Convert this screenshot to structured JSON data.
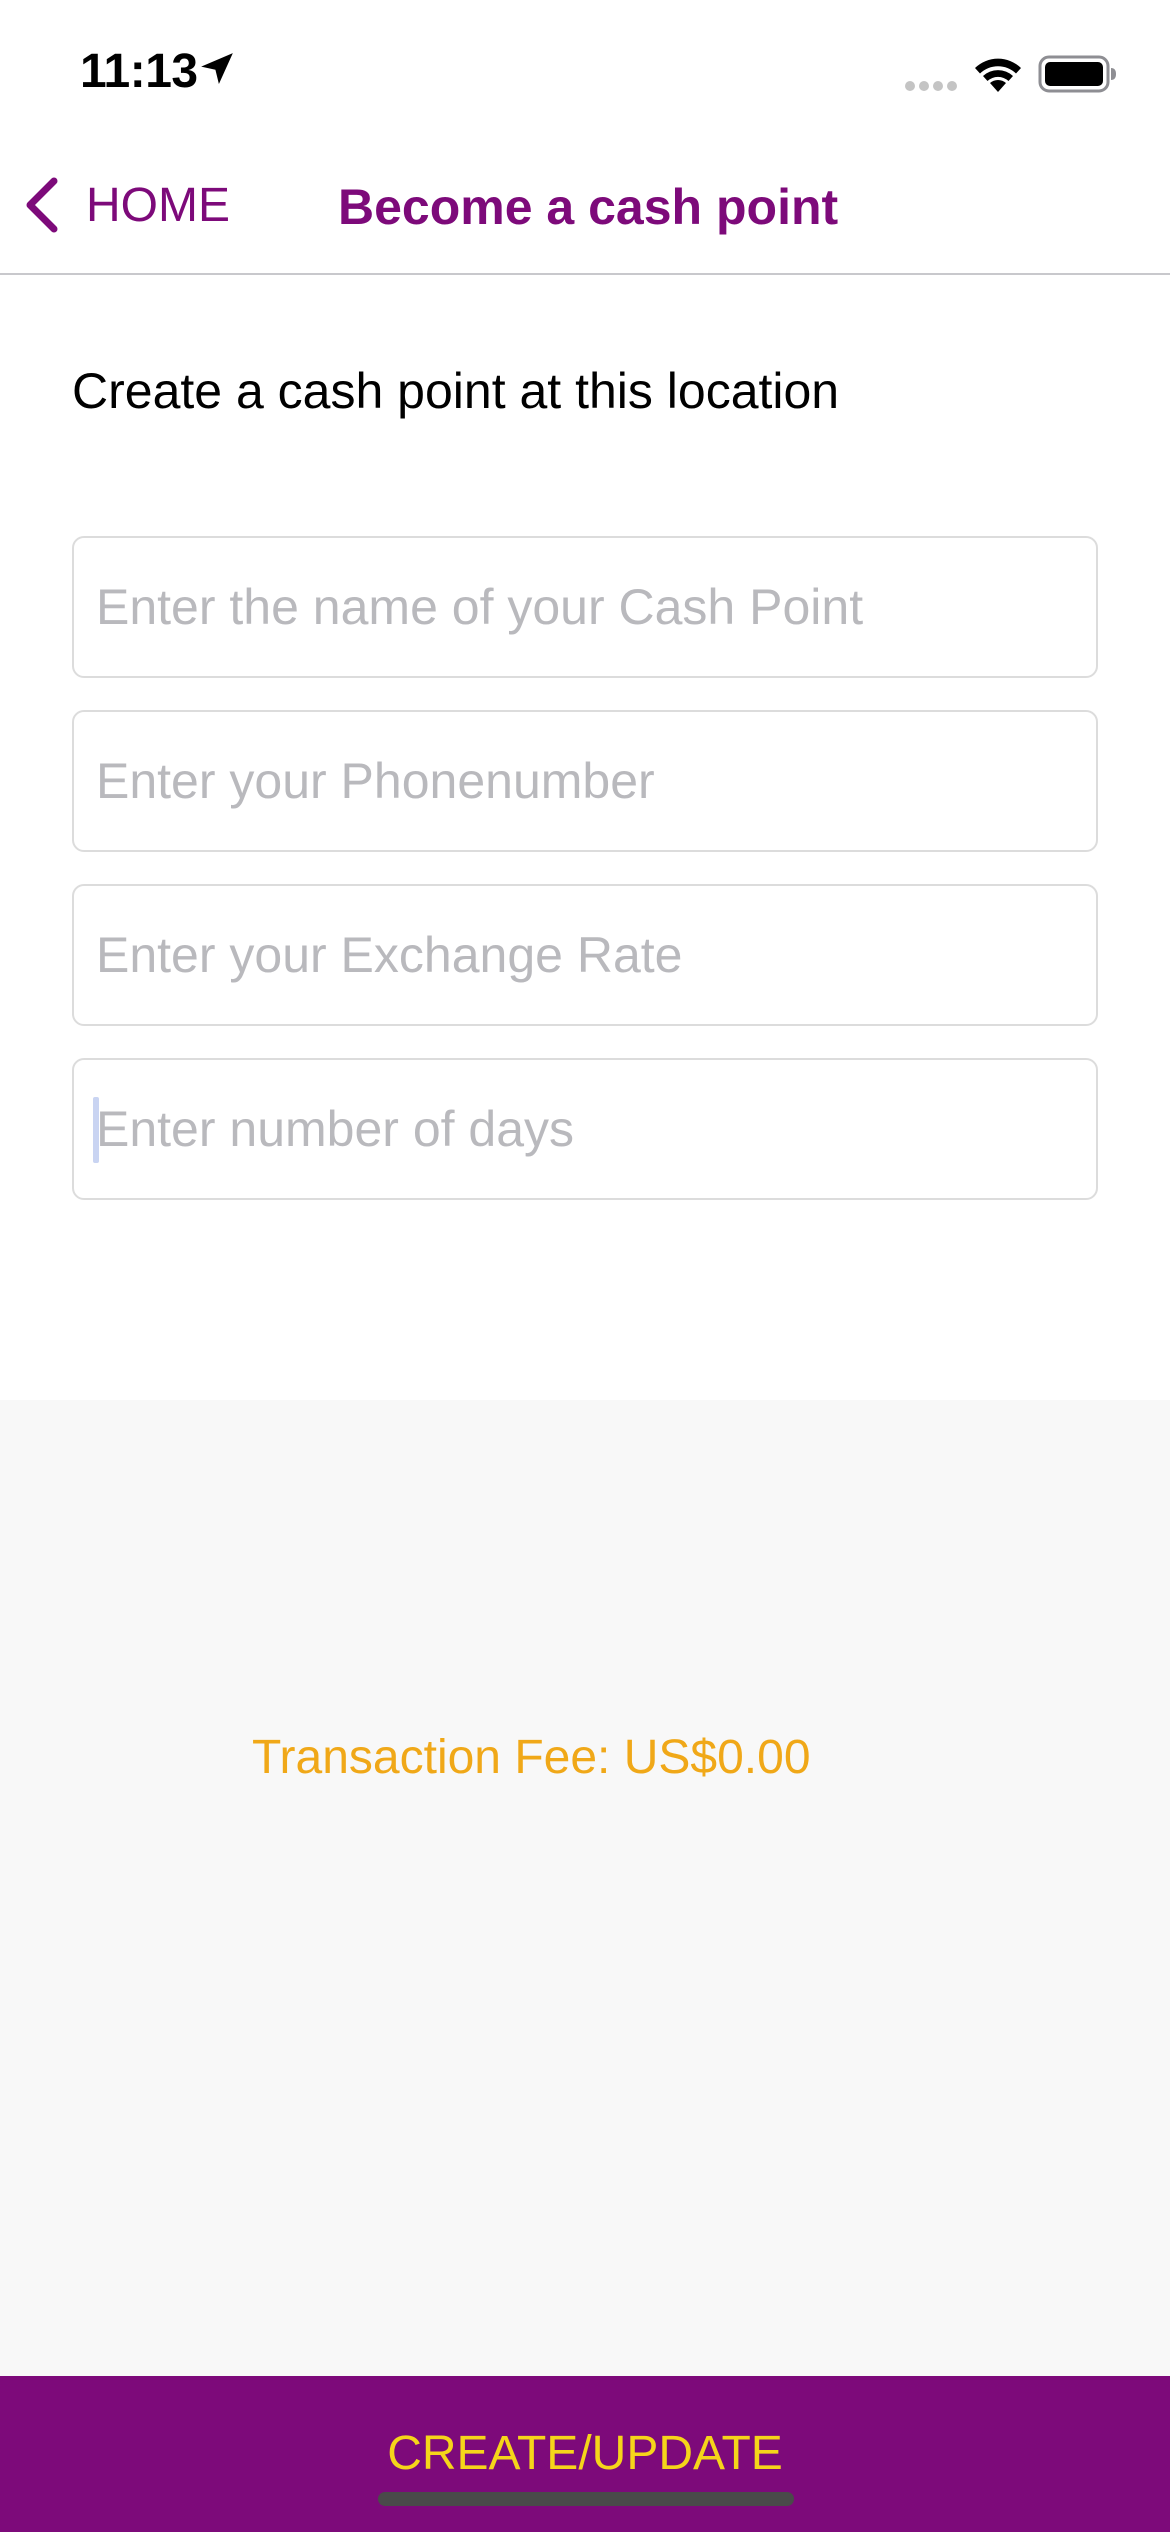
{
  "status_bar": {
    "time": "11:13",
    "icons": [
      "location-arrow-icon",
      "signal-dots-icon",
      "wifi-icon",
      "battery-icon"
    ]
  },
  "nav": {
    "back_label": "HOME",
    "title": "Become a cash point",
    "accent_color": "#7d0a7a"
  },
  "form": {
    "heading": "Create a cash point at this location",
    "fields": [
      {
        "placeholder": "Enter the name of your Cash Point",
        "value": ""
      },
      {
        "placeholder": "Enter your Phonenumber",
        "value": ""
      },
      {
        "placeholder": "Enter your Exchange Rate",
        "value": ""
      },
      {
        "placeholder": "Enter number of days",
        "value": "",
        "focused": true
      }
    ]
  },
  "fee": {
    "text": "Transaction Fee: US$0.00",
    "color": "#f0a818"
  },
  "submit": {
    "label": "CREATE/UPDATE",
    "background": "#7d0a7a",
    "text_color": "#f5d51a"
  }
}
